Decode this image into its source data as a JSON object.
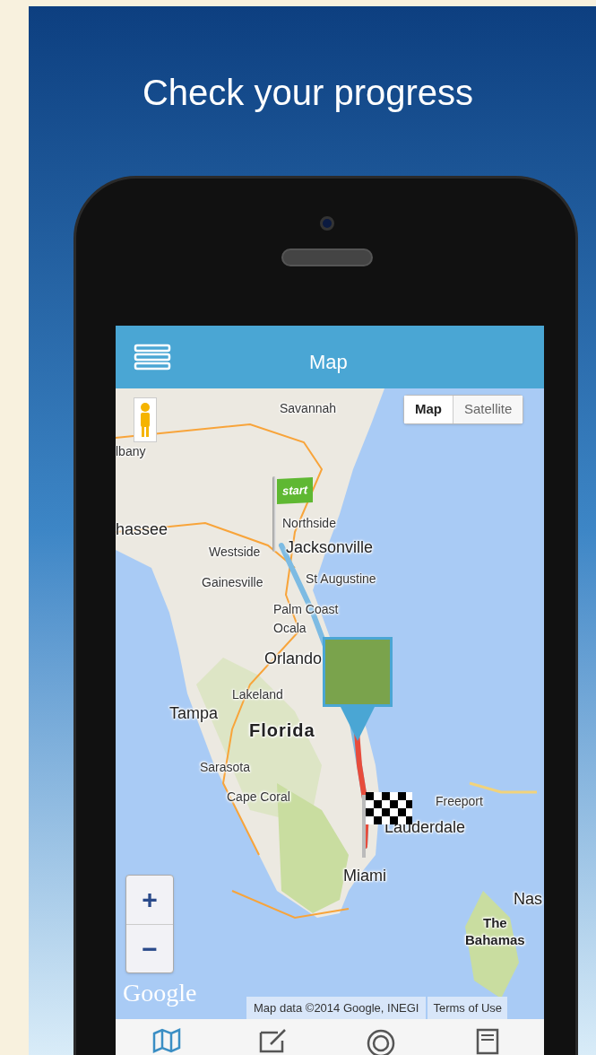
{
  "headline": "Check your progress",
  "app_bar": {
    "title": "Map"
  },
  "map_type": [
    {
      "label": "Map",
      "selected": true
    },
    {
      "label": "Satellite",
      "selected": false
    }
  ],
  "map_labels": [
    {
      "text": "Savannah",
      "kind": "city"
    },
    {
      "text": "lbany",
      "kind": "city"
    },
    {
      "text": "hassee",
      "kind": "large"
    },
    {
      "text": "Northside",
      "kind": "city"
    },
    {
      "text": "Westside",
      "kind": "city"
    },
    {
      "text": "Jacksonville",
      "kind": "large"
    },
    {
      "text": "St Augustine",
      "kind": "city"
    },
    {
      "text": "Gainesville",
      "kind": "city"
    },
    {
      "text": "Palm Coast",
      "kind": "city"
    },
    {
      "text": "Ocala",
      "kind": "city"
    },
    {
      "text": "Orlando",
      "kind": "large"
    },
    {
      "text": "Lakeland",
      "kind": "city"
    },
    {
      "text": "Tampa",
      "kind": "large"
    },
    {
      "text": "Florida",
      "kind": "region"
    },
    {
      "text": "Sarasota",
      "kind": "city"
    },
    {
      "text": "Cape Coral",
      "kind": "city"
    },
    {
      "text": "Freeport",
      "kind": "city"
    },
    {
      "text": "Lauderdale",
      "kind": "large"
    },
    {
      "text": "Miami",
      "kind": "large"
    },
    {
      "text": "Nas",
      "kind": "large"
    },
    {
      "text": "The\nBahamas",
      "kind": "city_bold"
    }
  ],
  "start_flag": {
    "label": "start"
  },
  "zoom_controls": [
    "+",
    "−"
  ],
  "map_logo": "Google",
  "attribution": "Map data ©2014 Google, INEGI",
  "terms_link": "Terms of Use",
  "bottom_tabs": [
    {
      "kind": "map",
      "selected": true
    },
    {
      "kind": "edit",
      "selected": false
    },
    {
      "kind": "target",
      "selected": false
    },
    {
      "kind": "list",
      "selected": false
    }
  ]
}
